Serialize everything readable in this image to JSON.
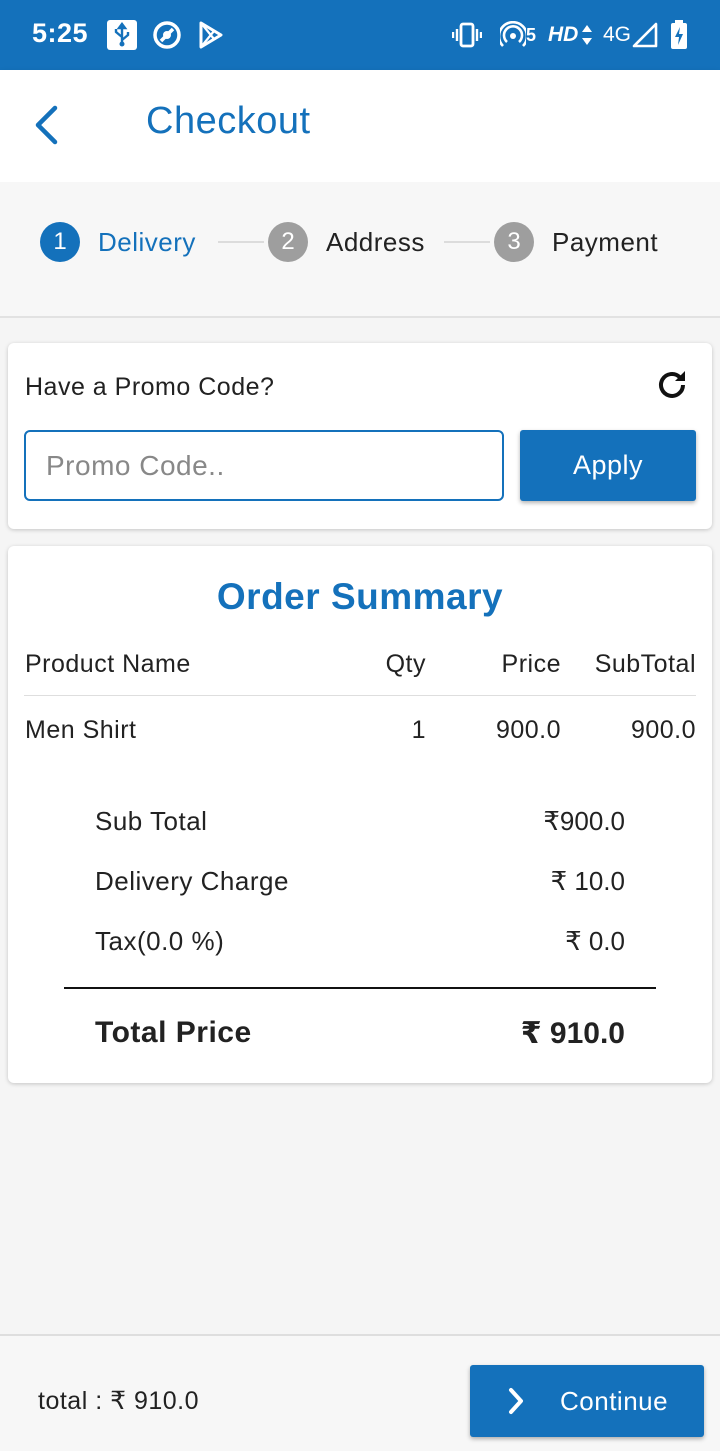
{
  "status_bar": {
    "time": "5:25",
    "icons": [
      "usb-icon",
      "sync-icon",
      "play-store-icon",
      "vibrate-icon",
      "hotspot-icon",
      "hd-icon",
      "4g-icon",
      "signal-icon",
      "battery-charging-icon"
    ],
    "network_label": "4G",
    "hd_label": "HD",
    "hotspot_count": "5"
  },
  "app_bar": {
    "title": "Checkout",
    "back_icon": "arrow-back-icon"
  },
  "stepper": {
    "steps": [
      {
        "number": "1",
        "label": "Delivery",
        "active": true
      },
      {
        "number": "2",
        "label": "Address",
        "active": false
      },
      {
        "number": "3",
        "label": "Payment",
        "active": false
      }
    ]
  },
  "promo": {
    "title": "Have a Promo Code?",
    "placeholder": "Promo Code..",
    "value": "",
    "apply_label": "Apply",
    "refresh_icon": "refresh-icon"
  },
  "order_summary": {
    "title": "Order Summary",
    "columns": [
      "Product Name",
      "Qty",
      "Price",
      "SubTotal"
    ],
    "items": [
      {
        "name": "Men Shirt",
        "qty": "1",
        "price": "900.0",
        "subtotal": "900.0"
      }
    ],
    "sub_total_label": "Sub Total",
    "sub_total_value": "₹900.0",
    "delivery_label": "Delivery Charge",
    "delivery_value": "₹ 10.0",
    "tax_label": "Tax(0.0 %)",
    "tax_value": "₹ 0.0",
    "total_label": "Total Price",
    "total_value": "₹ 910.0"
  },
  "bottom_bar": {
    "total_text": "total : ₹ 910.0",
    "continue_label": "Continue",
    "continue_icon": "chevron-right-icon"
  },
  "colors": {
    "primary": "#1471bb",
    "inactive_step": "#9e9e9e",
    "background": "#f5f5f5"
  }
}
